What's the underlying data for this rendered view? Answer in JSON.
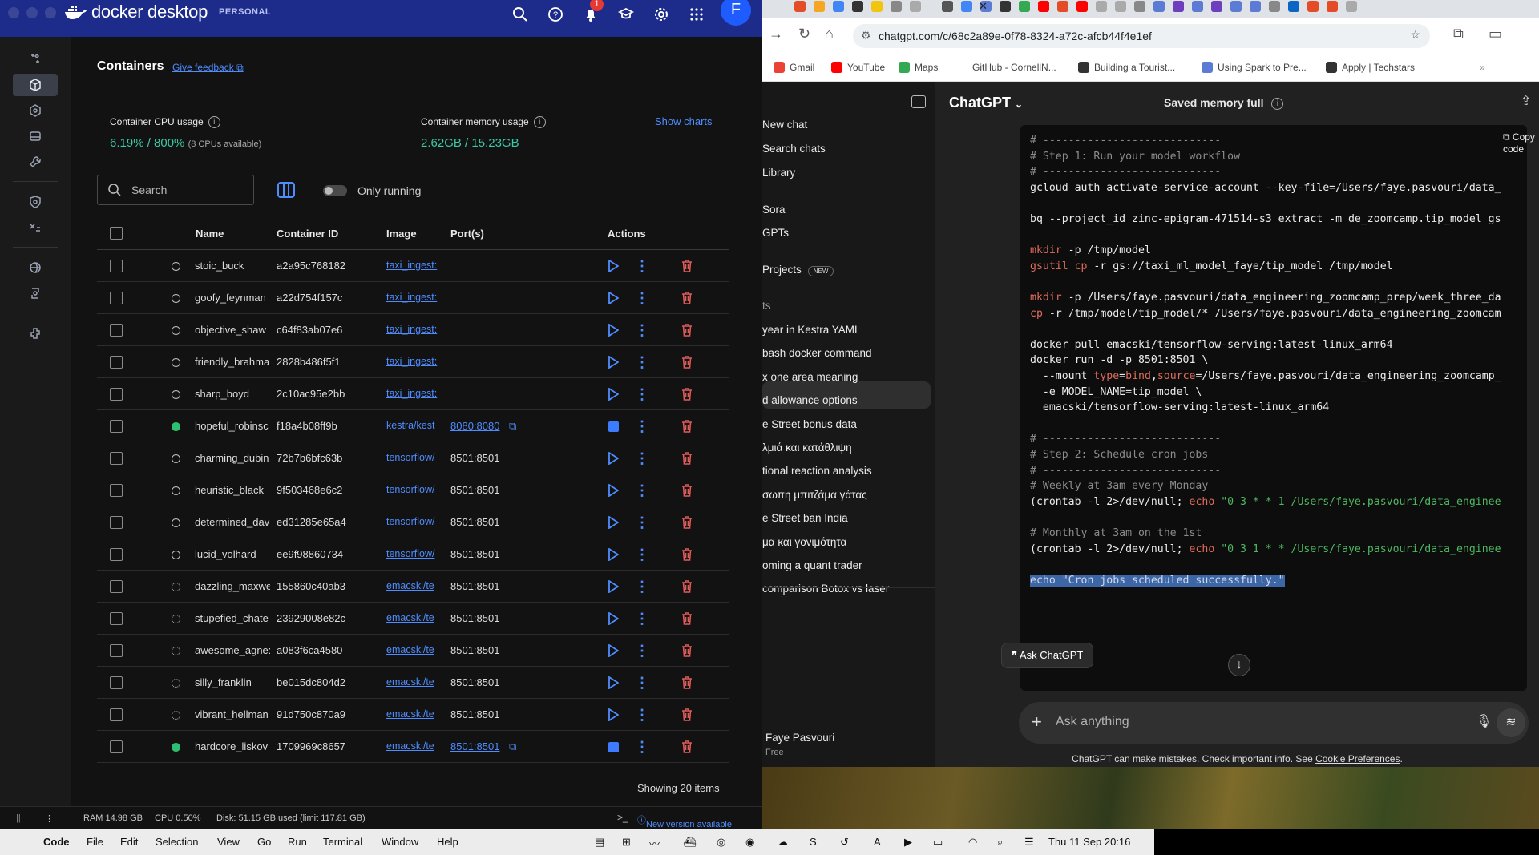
{
  "docker": {
    "logo_text": "docker desktop",
    "plan": "PERSONAL",
    "notif_count": "1",
    "avatar": "F",
    "page_title": "Containers",
    "feedback": "Give feedback",
    "cpu_label": "Container CPU usage",
    "cpu_value": "6.19% / 800%",
    "cpu_note": "(8 CPUs available)",
    "mem_label": "Container memory usage",
    "mem_value": "2.62GB / 15.23GB",
    "show_charts": "Show charts",
    "search_placeholder": "Search",
    "only_running": "Only running",
    "columns": [
      "Name",
      "Container ID",
      "Image",
      "Port(s)",
      "Actions"
    ],
    "rows": [
      {
        "name": "stoic_buck",
        "id": "a2a95c768182",
        "image": "taxi_ingest:",
        "port": "",
        "status": "stopped"
      },
      {
        "name": "goofy_feynman",
        "id": "a22d754f157c",
        "image": "taxi_ingest:",
        "port": "",
        "status": "stopped"
      },
      {
        "name": "objective_shaw",
        "id": "c64f83ab07e6",
        "image": "taxi_ingest:",
        "port": "",
        "status": "stopped"
      },
      {
        "name": "friendly_brahma",
        "id": "2828b486f5f1",
        "image": "taxi_ingest:",
        "port": "",
        "status": "stopped"
      },
      {
        "name": "sharp_boyd",
        "id": "2c10ac95e2bb",
        "image": "taxi_ingest:",
        "port": "",
        "status": "stopped"
      },
      {
        "name": "hopeful_robinsc",
        "id": "f18a4b08ff9b",
        "image": "kestra/kest",
        "port": "8080:8080",
        "status": "running"
      },
      {
        "name": "charming_dubin",
        "id": "72b7b6bfc63b",
        "image": "tensorflow/",
        "port": "8501:8501",
        "status": "stopped"
      },
      {
        "name": "heuristic_black",
        "id": "9f503468e6c2",
        "image": "tensorflow/",
        "port": "8501:8501",
        "status": "stopped"
      },
      {
        "name": "determined_dav",
        "id": "ed31285e65a4",
        "image": "tensorflow/",
        "port": "8501:8501",
        "status": "stopped"
      },
      {
        "name": "lucid_volhard",
        "id": "ee9f98860734",
        "image": "tensorflow/",
        "port": "8501:8501",
        "status": "stopped"
      },
      {
        "name": "dazzling_maxwe",
        "id": "155860c40ab3",
        "image": "emacski/te",
        "port": "8501:8501",
        "status": "created"
      },
      {
        "name": "stupefied_chate",
        "id": "23929008e82c",
        "image": "emacski/te",
        "port": "8501:8501",
        "status": "created"
      },
      {
        "name": "awesome_agne:",
        "id": "a083f6ca4580",
        "image": "emacski/te",
        "port": "8501:8501",
        "status": "created"
      },
      {
        "name": "silly_franklin",
        "id": "be015dc804d2",
        "image": "emacski/te",
        "port": "8501:8501",
        "status": "created"
      },
      {
        "name": "vibrant_hellman",
        "id": "91d750c870a9",
        "image": "emacski/te",
        "port": "8501:8501",
        "status": "created"
      },
      {
        "name": "hardcore_liskov",
        "id": "1709969c8657",
        "image": "emacski/te",
        "port": "8501:8501",
        "status": "running"
      }
    ],
    "showing": "Showing 20 items",
    "footer": {
      "ram": "RAM 14.98 GB",
      "cpu": "CPU 0.50%",
      "disk": "Disk: 51.15 GB used (limit 117.81 GB)",
      "update": "New version available"
    }
  },
  "browser": {
    "url": "chatgpt.com/c/68c2a89e-0f78-8324-a72c-afcb44f4e1ef",
    "bookmarks": [
      "Gmail",
      "YouTube",
      "Maps",
      "GitHub - CornellN...",
      "Building a Tourist...",
      "Using Spark to Pre...",
      "Apply | Techstars"
    ]
  },
  "chatgpt": {
    "title": "ChatGPT",
    "memory": "Saved memory full",
    "sidebar": [
      "New chat",
      "Search chats",
      "Library",
      "Sora",
      "GPTs",
      "Projects"
    ],
    "projects_badge": "NEW",
    "chats_header": "ts",
    "chats": [
      "year in Kestra YAML",
      "bash docker command",
      "x one area meaning",
      "d allowance options",
      "e Street bonus data",
      "λμιά και κατάθλιψη",
      "tional reaction analysis",
      "σωπη μπιτζάμα γάτας",
      "e Street ban India",
      "μα και γονιμότητα",
      "oming a quant trader",
      " comparison Botox vs laser"
    ],
    "user_name": "Faye Pasvouri",
    "user_plan": "Free",
    "copy_code": "Copy code",
    "ask_chip": "Ask ChatGPT",
    "input_placeholder": "Ask anything",
    "disclaimer": "ChatGPT can make mistakes. Check important info. See",
    "disclaimer_link": "Cookie Preferences",
    "code": [
      {
        "t": "cm",
        "s": "# ----------------------------"
      },
      {
        "t": "cm",
        "s": "# Step 1: Run your model workflow"
      },
      {
        "t": "cm",
        "s": "# ----------------------------"
      },
      {
        "t": "tx",
        "s": "gcloud auth activate-service-account --key-file=/Users/faye.pasvouri/data_"
      },
      {
        "t": "tx",
        "s": ""
      },
      {
        "t": "tx",
        "s": "bq --project_id zinc-epigram-471514-s3 extract -m de_zoomcamp.tip_model gs"
      },
      {
        "t": "tx",
        "s": ""
      },
      {
        "t": "mk",
        "a": "mkdir",
        "s": " -p /tmp/model"
      },
      {
        "t": "mk",
        "a": "gsutil ",
        "b": "cp",
        "s": " -r gs://taxi_ml_model_faye/tip_model /tmp/model"
      },
      {
        "t": "tx",
        "s": ""
      },
      {
        "t": "mk",
        "a": "mkdir",
        "s": " -p /Users/faye.pasvouri/data_engineering_zoomcamp_prep/week_three_da"
      },
      {
        "t": "mk",
        "a": "cp",
        "s": " -r /tmp/model/tip_model/* /Users/faye.pasvouri/data_engineering_zoomcam"
      },
      {
        "t": "tx",
        "s": ""
      },
      {
        "t": "tx",
        "s": "docker pull emacski/tensorflow-serving:latest-linux_arm64"
      },
      {
        "t": "tx",
        "s": "docker run -d -p 8501:8501 \\"
      },
      {
        "t": "mt",
        "s": "  --mount type=bind,source=/Users/faye.pasvouri/data_engineering_zoomcamp_"
      },
      {
        "t": "tx",
        "s": "  -e MODEL_NAME=tip_model \\"
      },
      {
        "t": "tx",
        "s": "  emacski/tensorflow-serving:latest-linux_arm64"
      },
      {
        "t": "tx",
        "s": ""
      },
      {
        "t": "cm",
        "s": "# ----------------------------"
      },
      {
        "t": "cm",
        "s": "# Step 2: Schedule cron jobs"
      },
      {
        "t": "cm",
        "s": "# ----------------------------"
      },
      {
        "t": "cm",
        "s": "# Weekly at 3am every Monday"
      },
      {
        "t": "cr",
        "s": "(crontab -l 2>/dev/null; ",
        "e": "echo",
        "q": " \"0 3 * * 1 /Users/faye.pasvouri/data_enginee"
      },
      {
        "t": "tx",
        "s": ""
      },
      {
        "t": "cm",
        "s": "# Monthly at 3am on the 1st"
      },
      {
        "t": "cr",
        "s": "(crontab -l 2>/dev/null; ",
        "e": "echo",
        "q": " \"0 3 1 * * /Users/faye.pasvouri/data_enginee"
      },
      {
        "t": "tx",
        "s": ""
      },
      {
        "t": "hl",
        "s": "echo \"Cron jobs scheduled successfully.\""
      }
    ]
  },
  "menubar": {
    "app": "Code",
    "items": [
      "File",
      "Edit",
      "Selection",
      "View",
      "Go",
      "Run",
      "Terminal",
      "Window",
      "Help"
    ],
    "clock": "Thu 11 Sep  20:16"
  }
}
